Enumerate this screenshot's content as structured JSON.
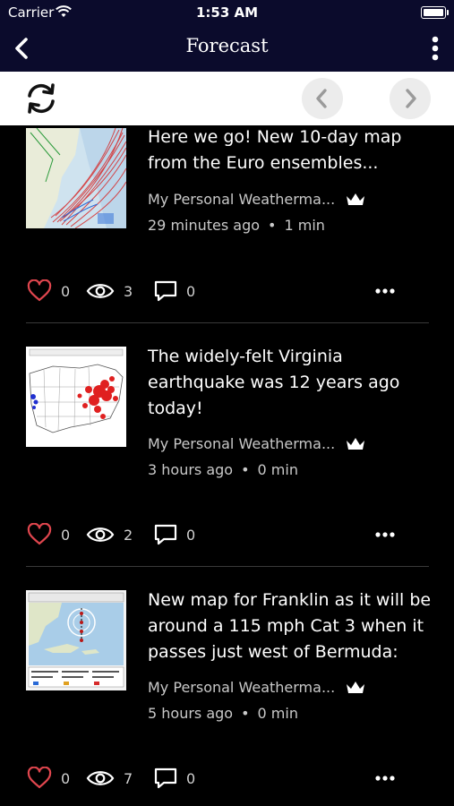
{
  "status_bar": {
    "carrier": "Carrier",
    "time": "1:53 AM"
  },
  "nav": {
    "title": "Forecast"
  },
  "posts": [
    {
      "title": "Here we go! New 10-day map from the Euro ensembles...",
      "author": "My Personal Weatherma...",
      "time_ago": "29 minutes ago",
      "read_time": "1 min",
      "likes": "0",
      "views": "3",
      "comments": "0"
    },
    {
      "title": "The widely-felt Virginia earthquake was 12 years ago today!",
      "author": "My Personal Weatherma...",
      "time_ago": "3 hours ago",
      "read_time": "0 min",
      "likes": "0",
      "views": "2",
      "comments": "0"
    },
    {
      "title": "New map for Franklin as it will be around a 115 mph Cat 3 when it passes just west of Bermuda:",
      "author": "My Personal Weatherma...",
      "time_ago": "5 hours ago",
      "read_time": "0 min",
      "likes": "0",
      "views": "7",
      "comments": "0"
    }
  ],
  "colors": {
    "nav_bg": "#0b0b2c",
    "like_heart": "#e0464e",
    "meta_text": "#c9c9c9"
  }
}
